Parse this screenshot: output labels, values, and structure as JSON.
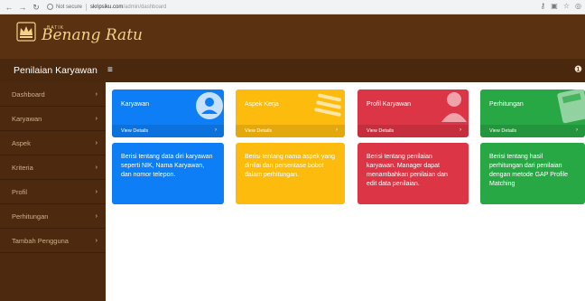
{
  "browser": {
    "security": "Not secure",
    "host": "skripsiku.com",
    "path": "/admin/dashboard"
  },
  "brand": {
    "small": "BATIK",
    "name": "Benang Ratu"
  },
  "subbar": {
    "title": "Penilaian Karyawan",
    "toggle": "≡"
  },
  "sidebar": {
    "items": [
      {
        "label": "Dashboard"
      },
      {
        "label": "Karyawan"
      },
      {
        "label": "Aspek"
      },
      {
        "label": "Kriteria"
      },
      {
        "label": "Profil"
      },
      {
        "label": "Perhitungan"
      },
      {
        "label": "Tambah Pengguna"
      }
    ]
  },
  "cards": [
    {
      "title": "Karyawan",
      "link": "View Details",
      "desc": "Berisi tentang data diri karyawan seperti NIK, Nama Karyawan, dan nomor telepon."
    },
    {
      "title": "Aspek Kerja",
      "link": "View Details",
      "desc": "Berisi tentang nama aspek yang dinilai dan persentase bobot dalam perhitungan."
    },
    {
      "title": "Profil Karyawan",
      "link": "View Details",
      "desc": "Berisi tentang penilaian karyawan. Manager dapat menambahkan penilaian dan edit data penilaian."
    },
    {
      "title": "Perhitungan",
      "link": "View Details",
      "desc": "Berisi tentang hasil perhitungan dari penilaian dengan metode GAP Profile Matching"
    }
  ],
  "colors": {
    "header": "#5a3212",
    "sidebar": "#4d2a0f",
    "blue": "#0d7ef5",
    "yellow": "#fdbc0d",
    "red": "#dc3545",
    "green": "#28a745"
  }
}
